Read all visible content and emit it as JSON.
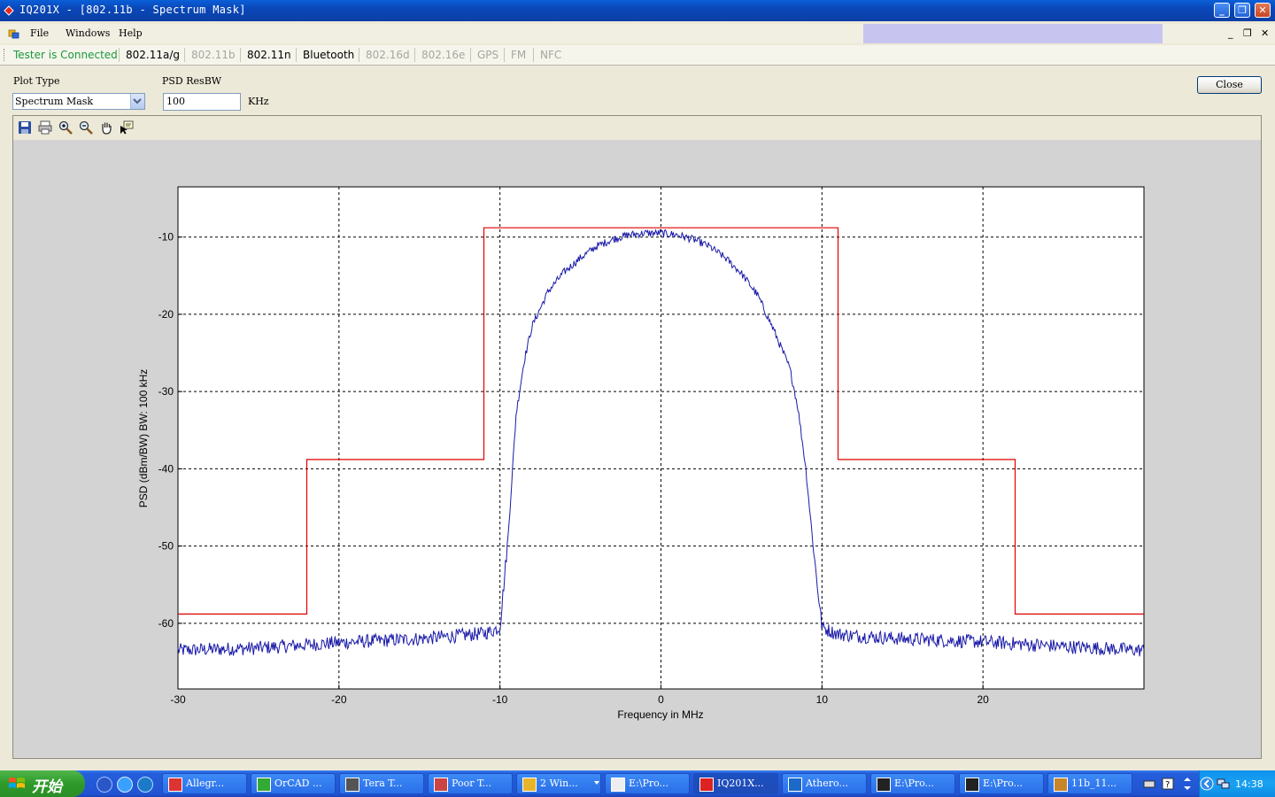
{
  "window": {
    "title": "IQ201X - [802.11b - Spectrum Mask]",
    "controls": {
      "minimize": "_",
      "restore": "❐",
      "close": "✕"
    }
  },
  "menu": {
    "items": [
      "File",
      "Windows",
      "Help"
    ],
    "mdi_minimize": "_",
    "mdi_restore": "❐",
    "mdi_close": "✕"
  },
  "status": {
    "connection": "Tester is Connected",
    "connection_color": "#1a9a3c"
  },
  "tabs": [
    {
      "label": "802.11a/g",
      "enabled": true
    },
    {
      "label": "802.11b",
      "enabled": false
    },
    {
      "label": "802.11n",
      "enabled": true
    },
    {
      "label": "Bluetooth",
      "enabled": true
    },
    {
      "label": "802.16d",
      "enabled": false
    },
    {
      "label": "802.16e",
      "enabled": false
    },
    {
      "label": "GPS",
      "enabled": false
    },
    {
      "label": "FM",
      "enabled": false
    },
    {
      "label": "NFC",
      "enabled": false
    }
  ],
  "controls": {
    "plot_type_label": "Plot Type",
    "plot_type_value": "Spectrum Mask",
    "resbw_label": "PSD ResBW",
    "resbw_value": "100",
    "resbw_unit": "KHz",
    "close_label": "Close"
  },
  "toolbar_icons": [
    "save-icon",
    "print-icon",
    "zoom-in-icon",
    "zoom-out-icon",
    "pan-hand-icon",
    "data-cursor-icon"
  ],
  "chart_data": {
    "type": "line",
    "title": "",
    "xlabel": "Frequency in MHz",
    "ylabel": "PSD (dBm/BW) BW: 100 kHz",
    "xlim": [
      -30,
      30
    ],
    "ylim": [
      -68.5,
      -3.5
    ],
    "xticks": [
      -30,
      -20,
      -10,
      0,
      10,
      20
    ],
    "yticks": [
      -10,
      -20,
      -30,
      -40,
      -50,
      -60
    ],
    "grid": true,
    "series": [
      {
        "role": "mask",
        "color": "#e00000",
        "x": [
          -30,
          -22,
          -22,
          -11,
          -11,
          11,
          11,
          22,
          22,
          30
        ],
        "y": [
          -58.8,
          -58.8,
          -38.8,
          -38.8,
          -8.8,
          -8.8,
          -38.8,
          -38.8,
          -58.8,
          -58.8
        ]
      },
      {
        "role": "measured-psd",
        "color": "#1a1aa8",
        "x": [
          -30,
          -25,
          -20,
          -15,
          -12,
          -11,
          -10.5,
          -10,
          -9.5,
          -9,
          -8.5,
          -8,
          -7,
          -6,
          -5,
          -4,
          -3,
          -2,
          -1,
          0,
          1,
          2,
          3,
          4,
          5,
          6,
          7,
          8,
          8.5,
          9,
          9.5,
          10,
          10.5,
          11,
          12,
          15,
          20,
          25,
          30
        ],
        "y": [
          -63.5,
          -63.2,
          -62.5,
          -62.0,
          -61.5,
          -61.3,
          -61.0,
          -60.5,
          -49.0,
          -33.0,
          -26.0,
          -21.5,
          -17.0,
          -14.5,
          -12.7,
          -11.2,
          -10.3,
          -9.7,
          -9.5,
          -9.5,
          -9.7,
          -10.3,
          -11.2,
          -12.7,
          -14.7,
          -17.5,
          -22.0,
          -27.0,
          -32.0,
          -40.0,
          -51.0,
          -60.5,
          -61.0,
          -61.4,
          -61.6,
          -62.0,
          -62.4,
          -63.0,
          -63.5
        ]
      }
    ]
  },
  "taskbar": {
    "start_label": "开始",
    "buttons": [
      "Allegr...",
      "OrCAD ...",
      "Tera T...",
      "Poor T...",
      "2 Win...",
      "E:\\Pro...",
      "IQ201X...",
      "Athero...",
      "E:\\Pro...",
      "E:\\Pro...",
      "11b_11..."
    ],
    "active_index": 6,
    "clock": "14:38"
  }
}
